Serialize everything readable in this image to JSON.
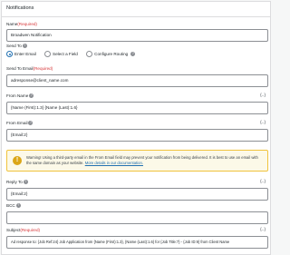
{
  "header": {
    "title": "Notifications"
  },
  "name": {
    "label": "Name",
    "required": "(Required)",
    "value": "Broadwen Notification"
  },
  "send_to": {
    "label": "Send To",
    "options": [
      "Enter Email",
      "Select a Field",
      "Configure Routing"
    ],
    "selected": "Enter Email"
  },
  "send_to_email": {
    "label": "Send To Email",
    "required": "(Required)",
    "value": "adresponse@client_name.com"
  },
  "from_name": {
    "label": "From Name",
    "value": "{Name (First):1.3} {Name (Last):1.6}"
  },
  "from_email": {
    "label": "From Email",
    "value": "{Email:2}"
  },
  "warning": {
    "text": "Warning! Using a third-party email in the From Email field may prevent your notification from being delivered. It is best to use an email with the same domain as your website.",
    "link": "More details in our documentation."
  },
  "reply_to": {
    "label": "Reply To",
    "value": "{Email:2}"
  },
  "bcc": {
    "label": "BCC",
    "value": ""
  },
  "subject": {
    "label": "Subject",
    "required": "(Required)",
    "value": "Ad response to: {Job Ref:24} Job Application from {Name (First):1.3}, {Name (Last):1.6} for {Job Title:7} - {Job ID:9} from Client Name"
  },
  "common": {
    "merge_tag": "{..}",
    "help": "?"
  }
}
